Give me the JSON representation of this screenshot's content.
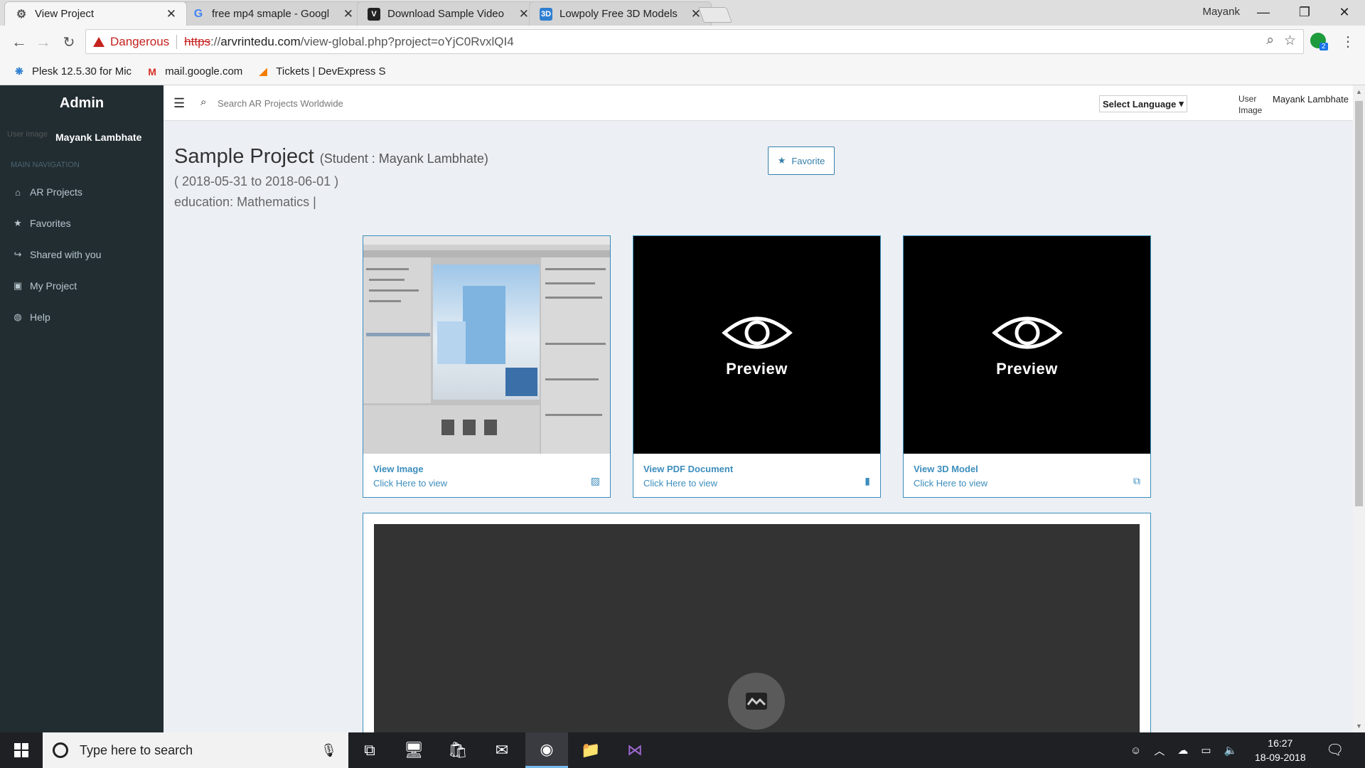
{
  "browser": {
    "tabs": [
      {
        "title": "View Project",
        "favicon": "gear-icon",
        "active": true
      },
      {
        "title": "free mp4 smaple - Googl",
        "favicon": "google-icon",
        "active": false
      },
      {
        "title": "Download Sample Video",
        "favicon": "v-icon",
        "active": false
      },
      {
        "title": "Lowpoly Free 3D Models",
        "favicon": "3d-icon",
        "active": false
      }
    ],
    "window_user": "Mayank",
    "security_label": "Dangerous",
    "url_scheme": "https",
    "url_sep": "://",
    "url_host": "arvrintedu.com",
    "url_path": "/view-global.php?project=oYjC0RvxlQI4",
    "bookmarks": [
      {
        "label": "Plesk 12.5.30 for Mic",
        "icon": "plesk-icon"
      },
      {
        "label": "mail.google.com",
        "icon": "gmail-icon"
      },
      {
        "label": "Tickets | DevExpress S",
        "icon": "devexpress-icon"
      }
    ]
  },
  "sidebar": {
    "brand": "Admin",
    "user_img_alt": "User Image",
    "user_name": "Mayank Lambhate",
    "nav_header": "MAIN NAVIGATION",
    "items": [
      {
        "label": "AR Projects",
        "icon": "home-icon"
      },
      {
        "label": "Favorites",
        "icon": "star-icon"
      },
      {
        "label": "Shared with you",
        "icon": "share-icon"
      },
      {
        "label": "My Project",
        "icon": "briefcase-icon"
      },
      {
        "label": "Help",
        "icon": "globe-icon"
      }
    ]
  },
  "topnav": {
    "search_placeholder": "Search AR Projects Worldwide",
    "language_label": "Select Language",
    "user_img_alt": "User Image",
    "user_name": "Mayank Lambhate"
  },
  "project": {
    "title": "Sample Project",
    "student": "(Student : Mayank Lambhate)",
    "dates": "( 2018-05-31 to 2018-06-01 )",
    "education": "education: Mathematics |",
    "favorite_label": "Favorite"
  },
  "cards": [
    {
      "title": "View Image",
      "subtitle": "Click Here to view",
      "icon": "image-icon"
    },
    {
      "title": "View PDF Document",
      "subtitle": "Click Here to view",
      "icon": "file-icon",
      "preview_label": "Preview"
    },
    {
      "title": "View 3D Model",
      "subtitle": "Click Here to view",
      "icon": "cube-icon",
      "preview_label": "Preview"
    }
  ],
  "taskbar": {
    "search_placeholder": "Type here to search",
    "time": "16:27",
    "date": "18-09-2018"
  },
  "colors": {
    "sidebar_bg": "#222d32",
    "accent": "#3c8dbc",
    "content_bg": "#ecf0f5",
    "danger": "#c5221f"
  }
}
